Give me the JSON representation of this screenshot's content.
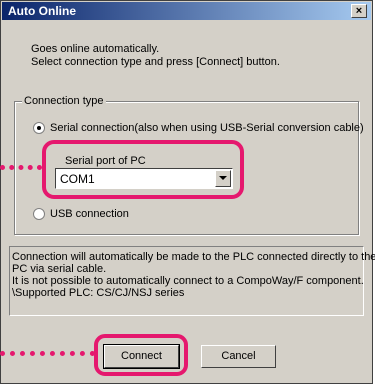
{
  "window": {
    "title": "Auto Online",
    "close_glyph": "×"
  },
  "intro": {
    "line1": "Goes online automatically.",
    "line2": "Select connection type and press [Connect] button."
  },
  "connection_type": {
    "label": "Connection type",
    "options": [
      {
        "label": "Serial connection(also when using USB-Serial conversion cable)",
        "checked": true
      },
      {
        "label": "USB connection",
        "checked": false
      }
    ],
    "serial_port": {
      "label": "Serial port of PC",
      "value": "COM1"
    }
  },
  "info": {
    "lines": [
      "Connection will automatically be made to the PLC connected directly to the",
      "PC via serial cable.",
      "It is not possible to automatically connect to a CompoWay/F component.",
      "\\Supported PLC: CS/CJ/NSJ series"
    ]
  },
  "buttons": {
    "connect": "Connect",
    "cancel": "Cancel"
  },
  "colors": {
    "highlight": "#e5186e",
    "titlebar_start": "#0a246a",
    "titlebar_end": "#a6caf0",
    "dialog_face": "#d4d0c8"
  },
  "icons": {
    "close": "close-icon",
    "dropdown": "chevron-down-icon"
  }
}
